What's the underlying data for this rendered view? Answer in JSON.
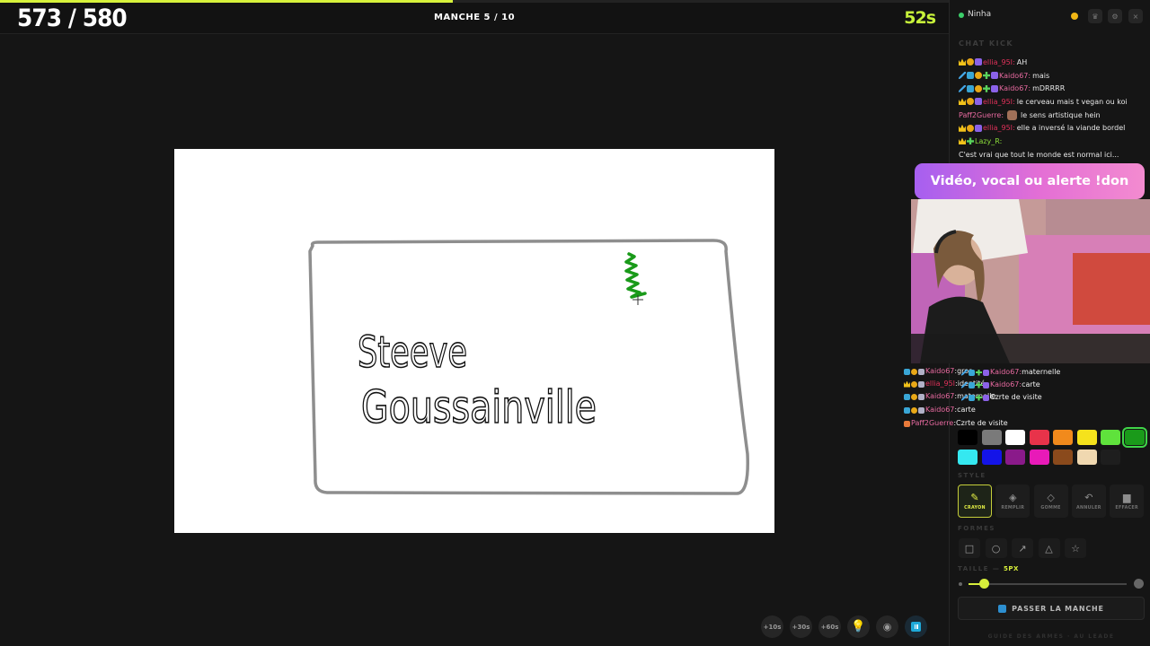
{
  "header": {
    "score": "573 / 580",
    "round": "MANCHE 5 / 10",
    "timer": "52s",
    "progress_fraction": 0.477
  },
  "canvas": {
    "text_line1": "Steeve",
    "text_line2": "Goussainville"
  },
  "bottom_tools": {
    "add_10": "+10s",
    "add_30": "+30s",
    "add_60": "+60s"
  },
  "sidebar": {
    "user_name": "Ninha",
    "chat_heading": "CHAT KICK",
    "chat": [
      {
        "badges": [
          "crown",
          "coin",
          "gem"
        ],
        "user": "ellia_95I",
        "user_color": "#e0315a",
        "text": "AH"
      },
      {
        "badges": [
          "sword",
          "grid",
          "coin",
          "plus",
          "gem"
        ],
        "user": "Kaido67",
        "user_color": "#e86aa0",
        "text": "mais"
      },
      {
        "badges": [
          "sword",
          "grid",
          "coin",
          "plus",
          "gem"
        ],
        "user": "Kaido67",
        "user_color": "#e86aa0",
        "text": "mDRRRR"
      },
      {
        "badges": [
          "crown",
          "coin",
          "gem"
        ],
        "user": "ellia_95I",
        "user_color": "#e0315a",
        "text": "le cerveau mais t vegan ou koi"
      },
      {
        "badges": [],
        "user": "Paff2Guerre",
        "user_color": "#e86aa0",
        "text": "le sens artistique hein",
        "emote": true
      },
      {
        "badges": [
          "crown",
          "coin",
          "gem"
        ],
        "user": "ellia_95I",
        "user_color": "#e0315a",
        "text": "elle a inversé la viande bordel"
      },
      {
        "badges": [
          "crown",
          "plus"
        ],
        "user": "Lazy_R",
        "user_color": "#8bdc3a",
        "text": ""
      },
      {
        "badges": [],
        "user": "",
        "user_color": "#e8e8e8",
        "text": "C'est vrai que tout le monde est normal ici..."
      }
    ],
    "banner": "Vidéo, vocal ou alerte !don",
    "overlay_chat_left": [
      {
        "badges": [
          "grid",
          "coin",
          "shield"
        ],
        "user": "Kaido67",
        "user_color": "#e86aa0",
        "text": "gros"
      },
      {
        "badges": [
          "crown",
          "coin",
          "shield"
        ],
        "user": "ellia_95I",
        "user_color": "#e0315a",
        "text": "identité"
      },
      {
        "badges": [
          "grid",
          "coin",
          "shield"
        ],
        "user": "Kaido67",
        "user_color": "#e86aa0",
        "text": "maternelle"
      },
      {
        "badges": [
          "grid",
          "coin",
          "shield"
        ],
        "user": "Kaido67",
        "user_color": "#e86aa0",
        "text": "carte"
      },
      {
        "badges": [
          "gift"
        ],
        "user": "Paff2Guerre",
        "user_color": "#e86aa0",
        "text": "Czrte de visite"
      }
    ],
    "overlay_chat_right": [
      {
        "user": "Kaido67",
        "user_color": "#e86aa0",
        "text": "maternelle"
      },
      {
        "user": "Kaido67",
        "user_color": "#e86aa0",
        "text": "carte"
      },
      {
        "user": "",
        "user_color": "#e8e8e8",
        "text": "Czrte de visite"
      }
    ],
    "palette": [
      "#000000",
      "#7a7a7a",
      "#ffffff",
      "#e8334a",
      "#f18a1c",
      "#f5e21c",
      "#5fe23c",
      "#1a9a1a",
      "#35e8f0",
      "#1414e8",
      "#8a1a8a",
      "#e81ab8",
      "#8a4a1c",
      "#f0d8b0",
      "#1e1e1e"
    ],
    "selected_color": "#1a9a1a",
    "style_label": "STYLE",
    "tools": [
      {
        "label": "CRAYON",
        "glyph": "✎",
        "active": true
      },
      {
        "label": "REMPLIR",
        "glyph": "◈",
        "active": false
      },
      {
        "label": "GOMME",
        "glyph": "◇",
        "active": false
      },
      {
        "label": "ANNULER",
        "glyph": "↶",
        "active": false
      },
      {
        "label": "EFFACER",
        "glyph": "▆",
        "active": false
      }
    ],
    "shapes_label": "FORMES",
    "shapes": [
      "□",
      "○",
      "↗",
      "△",
      "☆"
    ],
    "size_label": "TAILLE —",
    "size_value": "5PX",
    "size_fraction": 0.1,
    "skip_label": "PASSER LA MANCHE",
    "footer_hint": "GUIDE DES ARMES · AU LEADE"
  }
}
